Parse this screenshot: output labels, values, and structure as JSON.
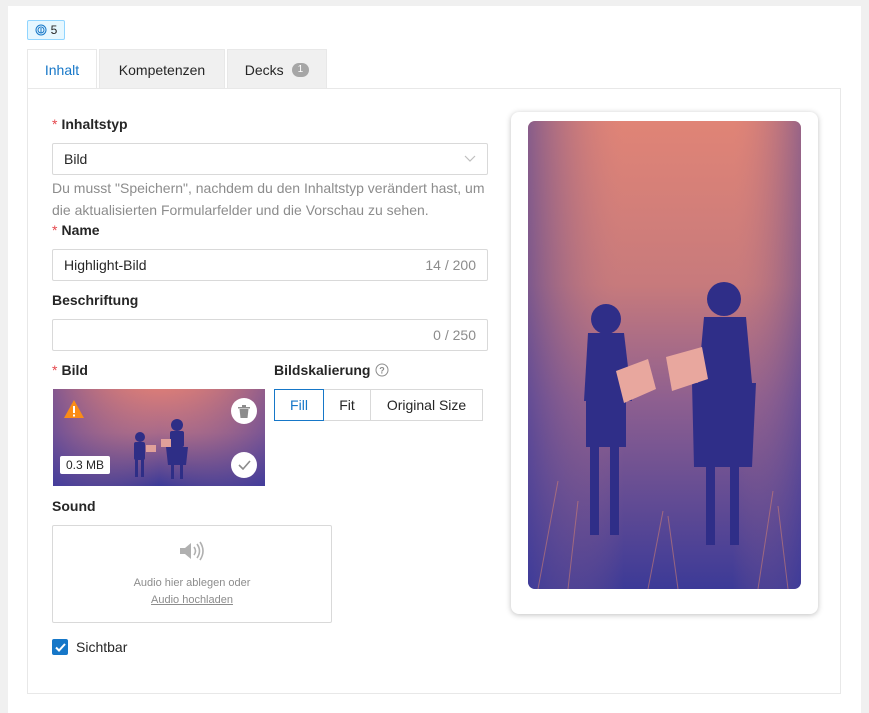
{
  "badge": {
    "icon": "fingerprint-icon",
    "count": "5"
  },
  "tabs": [
    {
      "label": "Inhalt",
      "active": true
    },
    {
      "label": "Kompetenzen"
    },
    {
      "label": "Decks",
      "count": "1"
    }
  ],
  "form": {
    "content_type": {
      "label": "Inhaltstyp",
      "value": "Bild",
      "hint": "Du musst \"Speichern\", nachdem du den Inhaltstyp verändert hast, um die aktualisierten Formularfelder und die Vorschau zu sehen."
    },
    "name": {
      "label": "Name",
      "value": "Highlight-Bild",
      "counter": "14 / 200"
    },
    "caption": {
      "label": "Beschriftung",
      "value": "",
      "counter": "0 / 250"
    },
    "image": {
      "label": "Bild",
      "size": "0.3 MB"
    },
    "scaling": {
      "label": "Bildskalierung",
      "options": [
        "Fill",
        "Fit",
        "Original Size"
      ],
      "selected": "Fill"
    },
    "sound": {
      "label": "Sound",
      "drop_text": "Audio hier ablegen oder",
      "upload_link": "Audio hochladen"
    },
    "visible": {
      "label": "Sichtbar",
      "checked": true
    }
  },
  "colors": {
    "accent": "#1677c8",
    "required": "#e5484d",
    "duotone_dark": "#3d3d99",
    "duotone_light": "#e8846f"
  }
}
